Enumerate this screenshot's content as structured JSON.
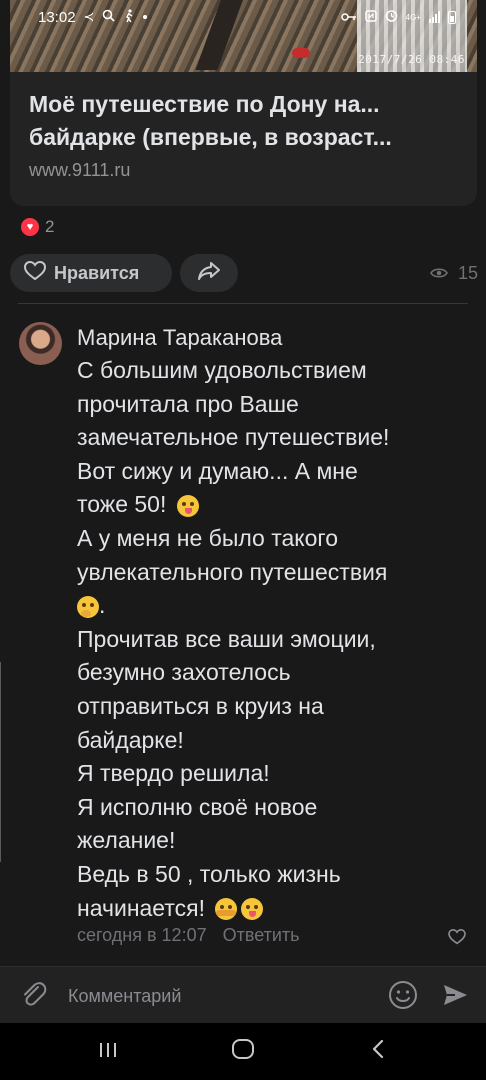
{
  "status_bar": {
    "time": "13:02",
    "left_icons": [
      "gesture-icon",
      "search-icon",
      "walk-icon",
      "dot"
    ],
    "right_icons": [
      "key-icon",
      "nfc-icon",
      "alarm-icon",
      "data-icon",
      "signal-icon",
      "battery-icon"
    ],
    "network_label": "4G+"
  },
  "card": {
    "image_stamp": "2017/7/26  08:46",
    "title_line1": "Моё путешествие по Дону на...",
    "title_line2": "байдарке (впервые, в возраст...",
    "url": "www.9111.ru"
  },
  "reactions": {
    "count": "2"
  },
  "actions": {
    "like_label": "Нравится",
    "views": "15"
  },
  "comment": {
    "author": "Марина Тараканова",
    "lines": [
      "С большим удовольствием",
      "прочитала про Ваше",
      "замечательное путешествие!",
      "Вот сижу и думаю... А мне",
      "тоже 50!",
      "А у меня не было  такого",
      "увлекательного путешествия",
      ".",
      "Прочитав  все ваши эмоции,",
      "безумно захотелось",
      "отправиться в круиз на",
      "байдарке!",
      "Я твердо решила!",
      "Я исполню своё новое",
      "желание!",
      "Ведь в 50 , только жизнь",
      "начинается!"
    ],
    "time": "сегодня в 12:07",
    "reply_label": "Ответить"
  },
  "composer": {
    "placeholder": "Комментарий"
  },
  "navbar": {
    "recent": "|||",
    "home": "O",
    "back": "<"
  },
  "colors": {
    "background": "#19191a",
    "card": "#232324",
    "accent_heart": "#ff3347",
    "secondary_text": "#939393"
  }
}
